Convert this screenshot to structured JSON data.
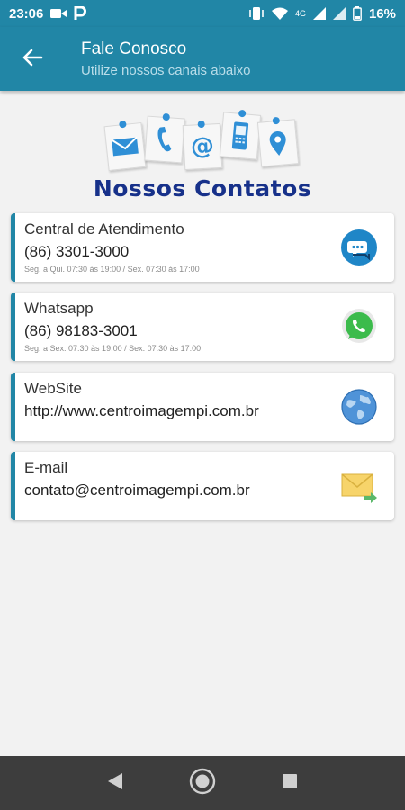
{
  "status_bar": {
    "time": "23:06",
    "network": "4G",
    "battery": "16%"
  },
  "app_bar": {
    "title": "Fale Conosco",
    "subtitle": "Utilize nossos canais abaixo"
  },
  "header": {
    "brand": "Nossos Contatos"
  },
  "contacts": [
    {
      "title": "Central de Atendimento",
      "value": "(86) 3301-3000",
      "hours": "Seg. a Qui. 07:30 às 19:00 / Sex. 07:30 às 17:00",
      "icon": "chat-bubble-icon"
    },
    {
      "title": "Whatsapp",
      "value": "(86) 98183-3001",
      "hours": "Seg. a Sex. 07:30 às 19:00 / Sex. 07:30 às 17:00",
      "icon": "whatsapp-icon"
    },
    {
      "title": "WebSite",
      "value": "http://www.centroimagempi.com.br",
      "icon": "globe-icon"
    },
    {
      "title": "E-mail",
      "value": "contato@centroimagempi.com.br",
      "icon": "email-send-icon"
    }
  ],
  "colors": {
    "primary": "#2186a6",
    "brand_text": "#17318a",
    "nav_bar": "#3d3d3d"
  }
}
